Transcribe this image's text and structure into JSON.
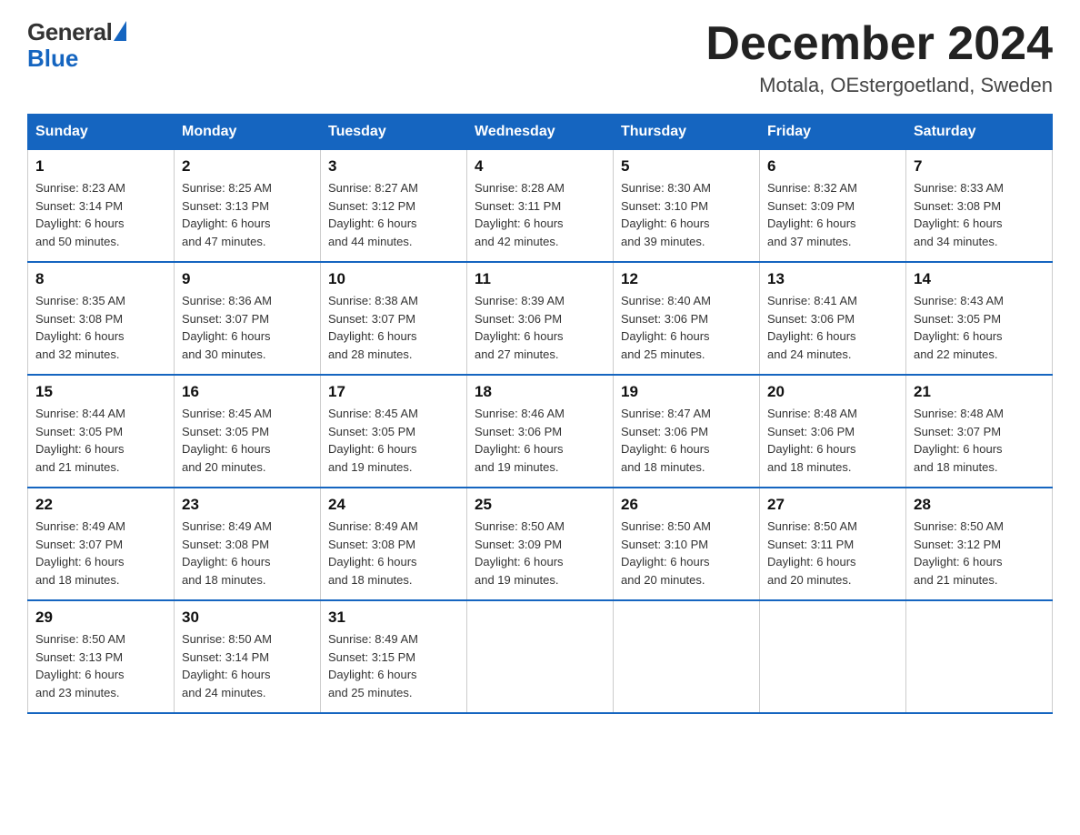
{
  "logo": {
    "general": "General",
    "blue": "Blue"
  },
  "title": {
    "month_year": "December 2024",
    "location": "Motala, OEstergoetland, Sweden"
  },
  "days_of_week": [
    "Sunday",
    "Monday",
    "Tuesday",
    "Wednesday",
    "Thursday",
    "Friday",
    "Saturday"
  ],
  "weeks": [
    [
      {
        "day": "1",
        "sunrise": "8:23 AM",
        "sunset": "3:14 PM",
        "daylight": "6 hours and 50 minutes."
      },
      {
        "day": "2",
        "sunrise": "8:25 AM",
        "sunset": "3:13 PM",
        "daylight": "6 hours and 47 minutes."
      },
      {
        "day": "3",
        "sunrise": "8:27 AM",
        "sunset": "3:12 PM",
        "daylight": "6 hours and 44 minutes."
      },
      {
        "day": "4",
        "sunrise": "8:28 AM",
        "sunset": "3:11 PM",
        "daylight": "6 hours and 42 minutes."
      },
      {
        "day": "5",
        "sunrise": "8:30 AM",
        "sunset": "3:10 PM",
        "daylight": "6 hours and 39 minutes."
      },
      {
        "day": "6",
        "sunrise": "8:32 AM",
        "sunset": "3:09 PM",
        "daylight": "6 hours and 37 minutes."
      },
      {
        "day": "7",
        "sunrise": "8:33 AM",
        "sunset": "3:08 PM",
        "daylight": "6 hours and 34 minutes."
      }
    ],
    [
      {
        "day": "8",
        "sunrise": "8:35 AM",
        "sunset": "3:08 PM",
        "daylight": "6 hours and 32 minutes."
      },
      {
        "day": "9",
        "sunrise": "8:36 AM",
        "sunset": "3:07 PM",
        "daylight": "6 hours and 30 minutes."
      },
      {
        "day": "10",
        "sunrise": "8:38 AM",
        "sunset": "3:07 PM",
        "daylight": "6 hours and 28 minutes."
      },
      {
        "day": "11",
        "sunrise": "8:39 AM",
        "sunset": "3:06 PM",
        "daylight": "6 hours and 27 minutes."
      },
      {
        "day": "12",
        "sunrise": "8:40 AM",
        "sunset": "3:06 PM",
        "daylight": "6 hours and 25 minutes."
      },
      {
        "day": "13",
        "sunrise": "8:41 AM",
        "sunset": "3:06 PM",
        "daylight": "6 hours and 24 minutes."
      },
      {
        "day": "14",
        "sunrise": "8:43 AM",
        "sunset": "3:05 PM",
        "daylight": "6 hours and 22 minutes."
      }
    ],
    [
      {
        "day": "15",
        "sunrise": "8:44 AM",
        "sunset": "3:05 PM",
        "daylight": "6 hours and 21 minutes."
      },
      {
        "day": "16",
        "sunrise": "8:45 AM",
        "sunset": "3:05 PM",
        "daylight": "6 hours and 20 minutes."
      },
      {
        "day": "17",
        "sunrise": "8:45 AM",
        "sunset": "3:05 PM",
        "daylight": "6 hours and 19 minutes."
      },
      {
        "day": "18",
        "sunrise": "8:46 AM",
        "sunset": "3:06 PM",
        "daylight": "6 hours and 19 minutes."
      },
      {
        "day": "19",
        "sunrise": "8:47 AM",
        "sunset": "3:06 PM",
        "daylight": "6 hours and 18 minutes."
      },
      {
        "day": "20",
        "sunrise": "8:48 AM",
        "sunset": "3:06 PM",
        "daylight": "6 hours and 18 minutes."
      },
      {
        "day": "21",
        "sunrise": "8:48 AM",
        "sunset": "3:07 PM",
        "daylight": "6 hours and 18 minutes."
      }
    ],
    [
      {
        "day": "22",
        "sunrise": "8:49 AM",
        "sunset": "3:07 PM",
        "daylight": "6 hours and 18 minutes."
      },
      {
        "day": "23",
        "sunrise": "8:49 AM",
        "sunset": "3:08 PM",
        "daylight": "6 hours and 18 minutes."
      },
      {
        "day": "24",
        "sunrise": "8:49 AM",
        "sunset": "3:08 PM",
        "daylight": "6 hours and 18 minutes."
      },
      {
        "day": "25",
        "sunrise": "8:50 AM",
        "sunset": "3:09 PM",
        "daylight": "6 hours and 19 minutes."
      },
      {
        "day": "26",
        "sunrise": "8:50 AM",
        "sunset": "3:10 PM",
        "daylight": "6 hours and 20 minutes."
      },
      {
        "day": "27",
        "sunrise": "8:50 AM",
        "sunset": "3:11 PM",
        "daylight": "6 hours and 20 minutes."
      },
      {
        "day": "28",
        "sunrise": "8:50 AM",
        "sunset": "3:12 PM",
        "daylight": "6 hours and 21 minutes."
      }
    ],
    [
      {
        "day": "29",
        "sunrise": "8:50 AM",
        "sunset": "3:13 PM",
        "daylight": "6 hours and 23 minutes."
      },
      {
        "day": "30",
        "sunrise": "8:50 AM",
        "sunset": "3:14 PM",
        "daylight": "6 hours and 24 minutes."
      },
      {
        "day": "31",
        "sunrise": "8:49 AM",
        "sunset": "3:15 PM",
        "daylight": "6 hours and 25 minutes."
      },
      null,
      null,
      null,
      null
    ]
  ],
  "labels": {
    "sunrise": "Sunrise:",
    "sunset": "Sunset:",
    "daylight": "Daylight:"
  },
  "accent_color": "#1565C0"
}
